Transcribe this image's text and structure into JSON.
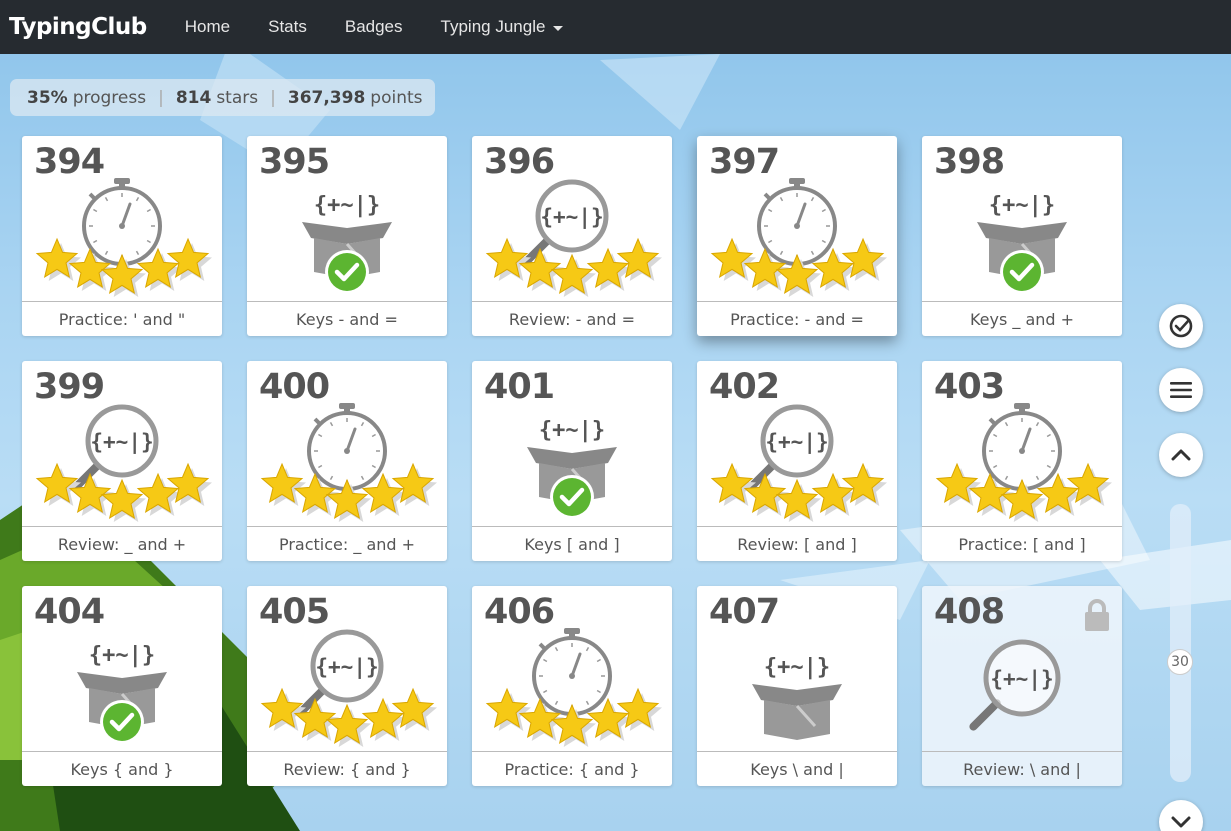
{
  "app": {
    "brand": "TypingClub"
  },
  "nav": {
    "home": "Home",
    "stats": "Stats",
    "badges": "Badges",
    "jungle": "Typing Jungle"
  },
  "progress": {
    "percent": "35%",
    "percent_label": "progress",
    "stars": "814",
    "stars_label": "stars",
    "points": "367,398",
    "points_label": "points"
  },
  "lessons": [
    {
      "num": "394",
      "label": "Practice: ' and \"",
      "type": "practice",
      "stars": 5
    },
    {
      "num": "395",
      "label": "Keys - and =",
      "type": "keys",
      "done": true
    },
    {
      "num": "396",
      "label": "Review: - and =",
      "type": "review",
      "stars": 5
    },
    {
      "num": "397",
      "label": "Practice: - and =",
      "type": "practice",
      "stars": 5
    },
    {
      "num": "398",
      "label": "Keys _ and +",
      "type": "keys",
      "done": true
    },
    {
      "num": "399",
      "label": "Review: _ and +",
      "type": "review",
      "stars": 5
    },
    {
      "num": "400",
      "label": "Practice: _ and +",
      "type": "practice",
      "stars": 5
    },
    {
      "num": "401",
      "label": "Keys [ and ]",
      "type": "keys",
      "done": true
    },
    {
      "num": "402",
      "label": "Review: [ and ]",
      "type": "review",
      "stars": 5
    },
    {
      "num": "403",
      "label": "Practice: [ and ]",
      "type": "practice",
      "stars": 5
    },
    {
      "num": "404",
      "label": "Keys { and }",
      "type": "keys",
      "done": true
    },
    {
      "num": "405",
      "label": "Review: { and }",
      "type": "review",
      "stars": 5
    },
    {
      "num": "406",
      "label": "Practice: { and }",
      "type": "practice",
      "stars": 5
    },
    {
      "num": "407",
      "label": "Keys \\ and |",
      "type": "keys",
      "done": false
    },
    {
      "num": "408",
      "label": "Review: \\ and |",
      "type": "review",
      "stars": 0,
      "locked": true
    }
  ],
  "icon_glyph": "{+~|}",
  "slider": {
    "value": "30"
  },
  "colors": {
    "navbar": "#262b30",
    "star": "#f6c915",
    "check": "#5cb531"
  }
}
